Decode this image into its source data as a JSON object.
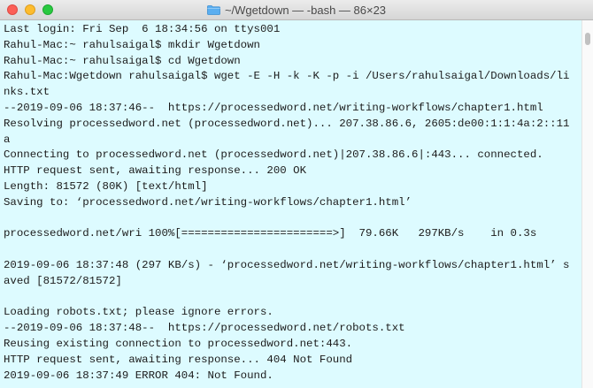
{
  "window": {
    "title": "~/Wgetdown — -bash — 86×23",
    "title_icon": "folder-icon",
    "background_color": "#ddfbff",
    "traffic_lights": {
      "close": "#fc5f57",
      "minimize": "#fdbc2e",
      "zoom": "#29c940"
    }
  },
  "terminal": {
    "lines": [
      "Last login: Fri Sep  6 18:34:56 on ttys001",
      "Rahul-Mac:~ rahulsaigal$ mkdir Wgetdown",
      "Rahul-Mac:~ rahulsaigal$ cd Wgetdown",
      "Rahul-Mac:Wgetdown rahulsaigal$ wget -E -H -k -K -p -i /Users/rahulsaigal/Downloads/li",
      "nks.txt",
      "--2019-09-06 18:37:46--  https://processedword.net/writing-workflows/chapter1.html",
      "Resolving processedword.net (processedword.net)... 207.38.86.6, 2605:de00:1:1:4a:2::11",
      "a",
      "Connecting to processedword.net (processedword.net)|207.38.86.6|:443... connected.",
      "HTTP request sent, awaiting response... 200 OK",
      "Length: 81572 (80K) [text/html]",
      "Saving to: ‘processedword.net/writing-workflows/chapter1.html’",
      "",
      "processedword.net/wri 100%[=======================>]  79.66K   297KB/s    in 0.3s",
      "",
      "2019-09-06 18:37:48 (297 KB/s) - ‘processedword.net/writing-workflows/chapter1.html’ s",
      "aved [81572/81572]",
      "",
      "Loading robots.txt; please ignore errors.",
      "--2019-09-06 18:37:48--  https://processedword.net/robots.txt",
      "Reusing existing connection to processedword.net:443.",
      "HTTP request sent, awaiting response... 404 Not Found",
      "2019-09-06 18:37:49 ERROR 404: Not Found."
    ]
  }
}
